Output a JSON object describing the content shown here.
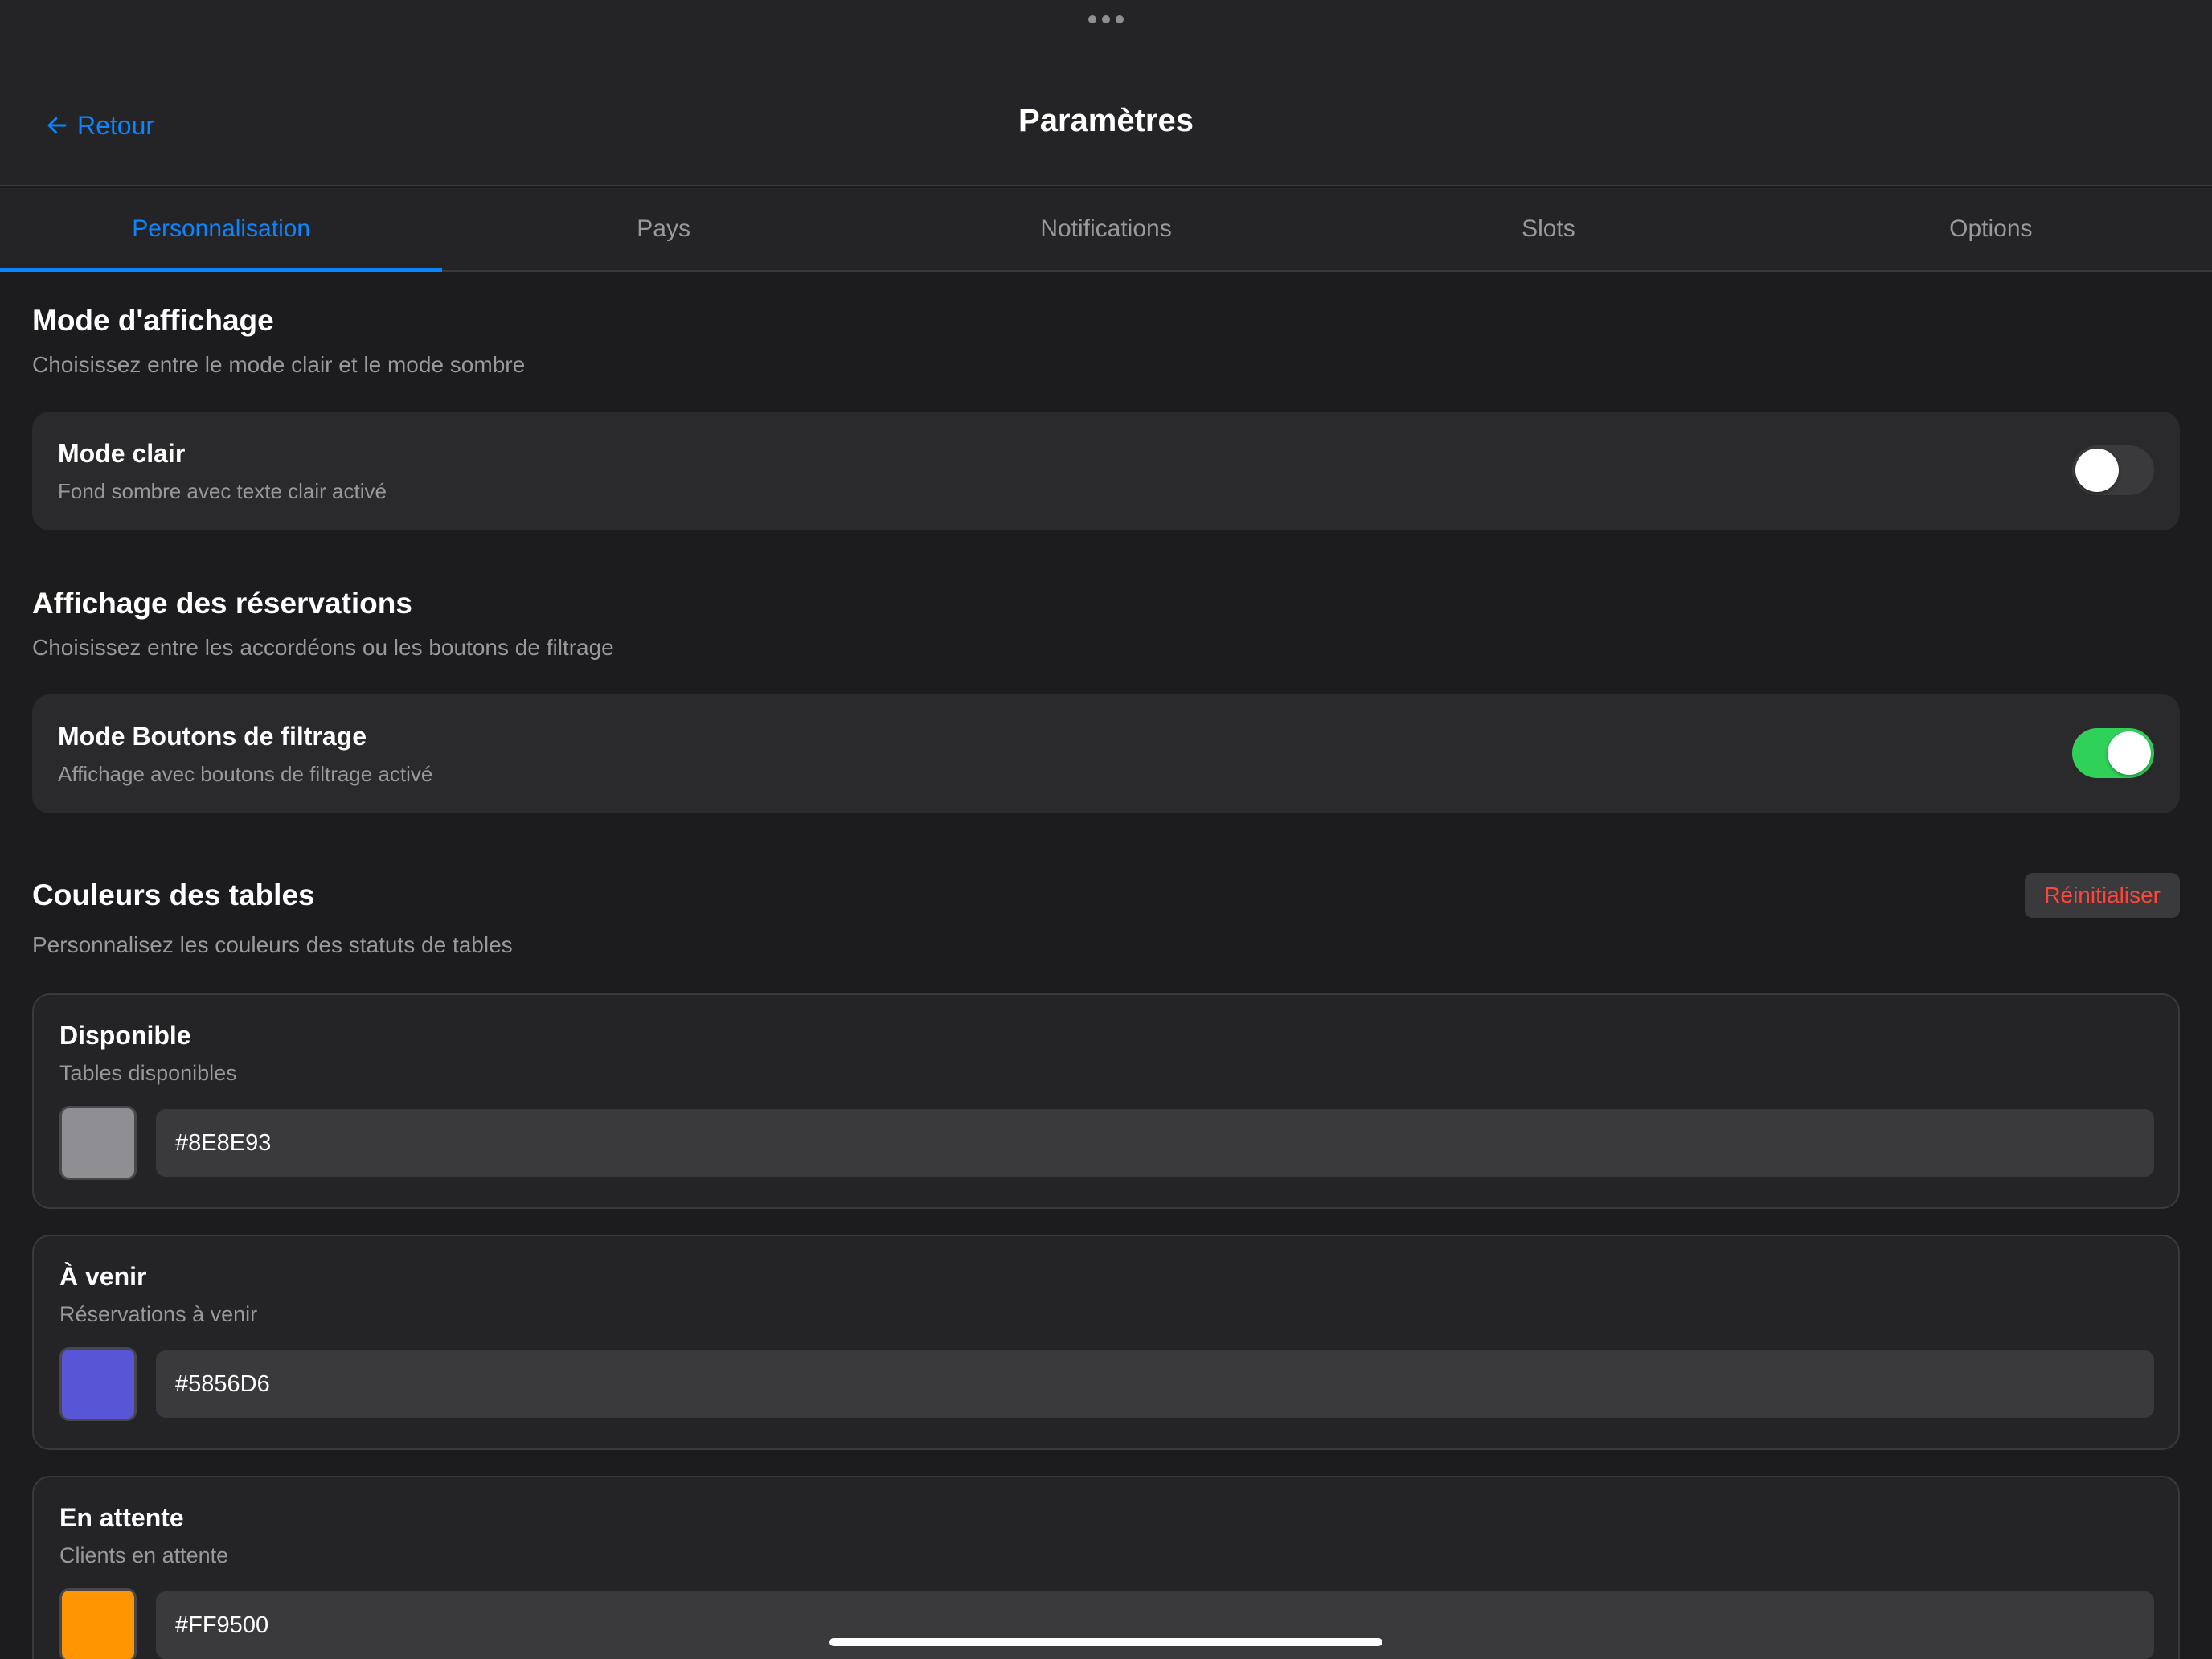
{
  "header": {
    "back_label": "Retour",
    "title": "Paramètres"
  },
  "tabs": [
    {
      "label": "Personnalisation",
      "active": true
    },
    {
      "label": "Pays",
      "active": false
    },
    {
      "label": "Notifications",
      "active": false
    },
    {
      "label": "Slots",
      "active": false
    },
    {
      "label": "Options",
      "active": false
    }
  ],
  "display_mode": {
    "title": "Mode d'affichage",
    "subtitle": "Choisissez entre le mode clair et le mode sombre",
    "toggle_title": "Mode clair",
    "toggle_subtitle": "Fond sombre avec texte clair activé",
    "enabled": false
  },
  "reservations_display": {
    "title": "Affichage des réservations",
    "subtitle": "Choisissez entre les accordéons ou les boutons de filtrage",
    "toggle_title": "Mode Boutons de filtrage",
    "toggle_subtitle": "Affichage avec boutons de filtrage activé",
    "enabled": true
  },
  "table_colors": {
    "title": "Couleurs des tables",
    "subtitle": "Personnalisez les couleurs des statuts de tables",
    "reset_label": "Réinitialiser",
    "items": [
      {
        "title": "Disponible",
        "subtitle": "Tables disponibles",
        "value": "#8E8E93",
        "color": "#8E8E93"
      },
      {
        "title": "À venir",
        "subtitle": "Réservations à venir",
        "value": "#5856D6",
        "color": "#5856D6"
      },
      {
        "title": "En attente",
        "subtitle": "Clients en attente",
        "value": "#FF9500",
        "color": "#FF9500"
      }
    ]
  },
  "colors": {
    "accent": "#0a84ff",
    "switch_on": "#30d158",
    "destructive": "#ff453a"
  }
}
